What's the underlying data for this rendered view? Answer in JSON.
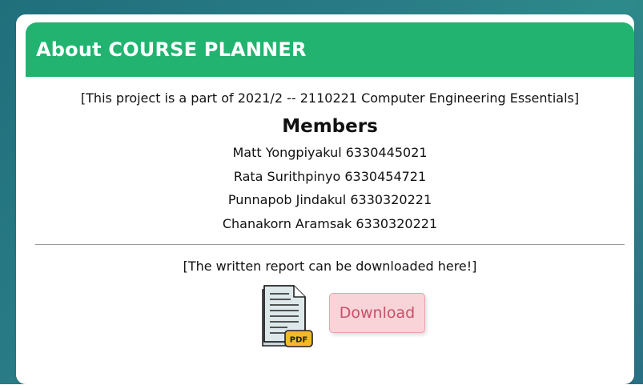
{
  "header": {
    "title": "About COURSE PLANNER"
  },
  "project_note": "[This project is a part of 2021/2 -- 2110221 Computer Engineering Essentials]",
  "members": {
    "title": "Members",
    "list": [
      "Matt Yongpiyakul 6330445021",
      "Rata Surithpinyo 6330454721",
      "Punnapob Jindakul 6330320221",
      "Chanakorn Aramsak 6330320221"
    ]
  },
  "report": {
    "note": "[The written report can be downloaded here!]",
    "icon_label": "PDF",
    "download_label": "Download"
  },
  "colors": {
    "header_bg": "#21b36f",
    "download_bg": "#f8d4d8",
    "download_text": "#c8506a"
  }
}
